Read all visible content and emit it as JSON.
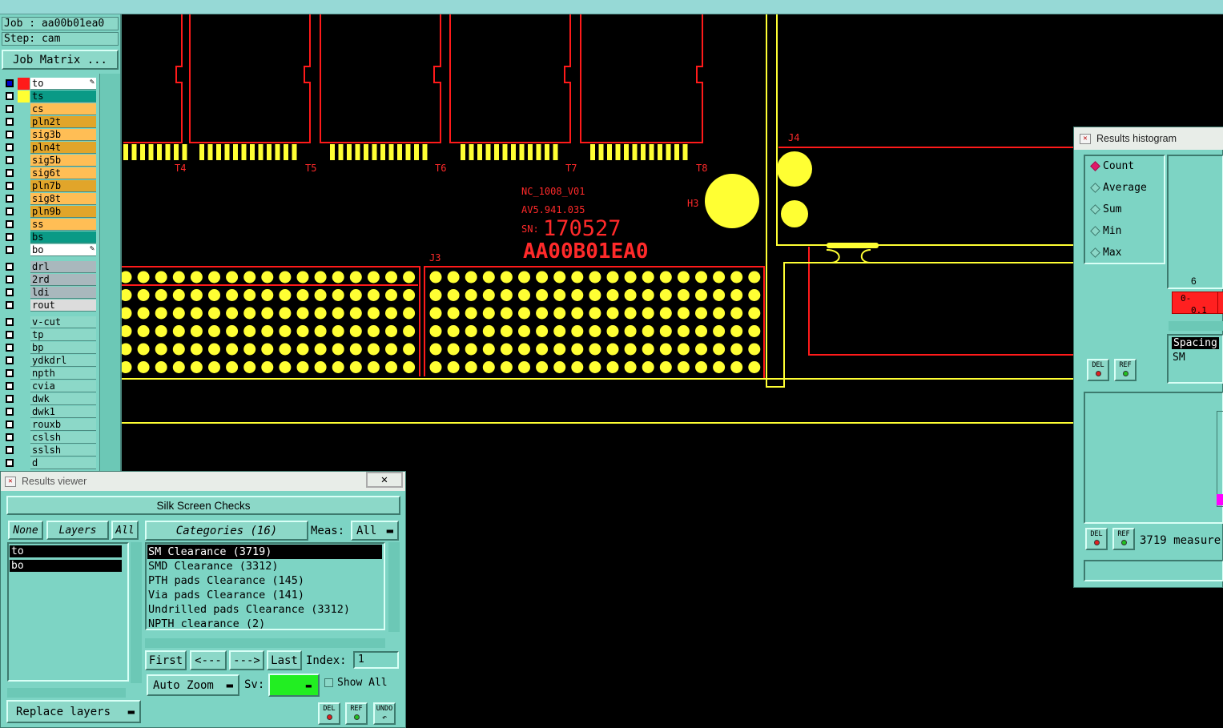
{
  "header": {
    "job_label": "Job : aa00b01ea0",
    "step_label": "Step: cam",
    "job_matrix_label": "Job Matrix ..."
  },
  "layers_board": [
    {
      "name": "to",
      "color": "#ffffff",
      "affected": true
    },
    {
      "name": "ts",
      "color": "#0a9a86"
    },
    {
      "name": "cs",
      "color": "#ffbe55"
    },
    {
      "name": "pln2t",
      "color": "#e1a52a"
    },
    {
      "name": "sig3b",
      "color": "#ffbe55"
    },
    {
      "name": "pln4t",
      "color": "#e1a52a"
    },
    {
      "name": "sig5b",
      "color": "#ffbe55"
    },
    {
      "name": "sig6t",
      "color": "#ffbe55"
    },
    {
      "name": "pln7b",
      "color": "#e1a52a"
    },
    {
      "name": "sig8t",
      "color": "#ffbe55"
    },
    {
      "name": "pln9b",
      "color": "#e1a52a"
    },
    {
      "name": "ss",
      "color": "#ffbe55"
    },
    {
      "name": "bs",
      "color": "#0a9a86"
    },
    {
      "name": "bo",
      "color": "#ffffff",
      "affected": true
    }
  ],
  "layers_drill": [
    {
      "name": "drl",
      "color": "#a9b8bd"
    },
    {
      "name": "2rd",
      "color": "#a9b8bd"
    },
    {
      "name": "ldi",
      "color": "#a9b8bd"
    },
    {
      "name": "rout",
      "color": "#dcdcdc"
    }
  ],
  "layers_misc": [
    {
      "name": "v-cut"
    },
    {
      "name": "tp"
    },
    {
      "name": "bp"
    },
    {
      "name": "ydkdrl"
    },
    {
      "name": "npth"
    },
    {
      "name": "cvia"
    },
    {
      "name": "dwk"
    },
    {
      "name": "dwk1"
    },
    {
      "name": "rouxb"
    },
    {
      "name": "cslsh"
    },
    {
      "name": "sslsh"
    },
    {
      "name": "d"
    }
  ],
  "canvas": {
    "silk_text": [
      "NC_1008_V01",
      "AV5.941.035",
      "SN:",
      "170527",
      "AA00B01EA0"
    ],
    "refdes": [
      "T4",
      "T5",
      "T6",
      "T7",
      "T8",
      "J3",
      "J4",
      "H3"
    ]
  },
  "results_viewer": {
    "title": "Results viewer",
    "check_name": "Silk Screen Checks",
    "none_label": "None",
    "layers_label": "Layers",
    "all_label": "All",
    "categories_label": "Categories (16)",
    "meas_label": "Meas:",
    "meas_value": "All",
    "layer_items": [
      "to",
      "bo"
    ],
    "categories": [
      "SM Clearance (3719)",
      "SMD Clearance (3312)",
      "PTH pads Clearance (145)",
      "Via pads Clearance (141)",
      "Undrilled pads Clearance (3312)",
      "NPTH clearance (2)"
    ],
    "first_label": "First",
    "prev_label": "<---",
    "next_label": "--->",
    "last_label": "Last",
    "index_label": "Index:",
    "index_value": "1",
    "zoom_label": "Auto Zoom",
    "sv_label": "Sv:",
    "show_all_label": "Show All",
    "replace_label": "Replace layers",
    "del_label": "DEL",
    "ref_label": "REF",
    "undo_label": "UNDO"
  },
  "histogram": {
    "title": "Results histogram",
    "options": [
      "Count",
      "Average",
      "Sum",
      "Min",
      "Max"
    ],
    "selected": "Count",
    "bar_count": "6",
    "bar_range": "0-",
    "bar_range2": "0.1",
    "spacing_label": "Spacing",
    "sm_label": "SM",
    "measure_text": "3719 measure",
    "del_label": "DEL",
    "ref_label": "REF",
    "colors": {
      "bar": "#ff2020",
      "selected_radio": "#e0186a"
    }
  }
}
